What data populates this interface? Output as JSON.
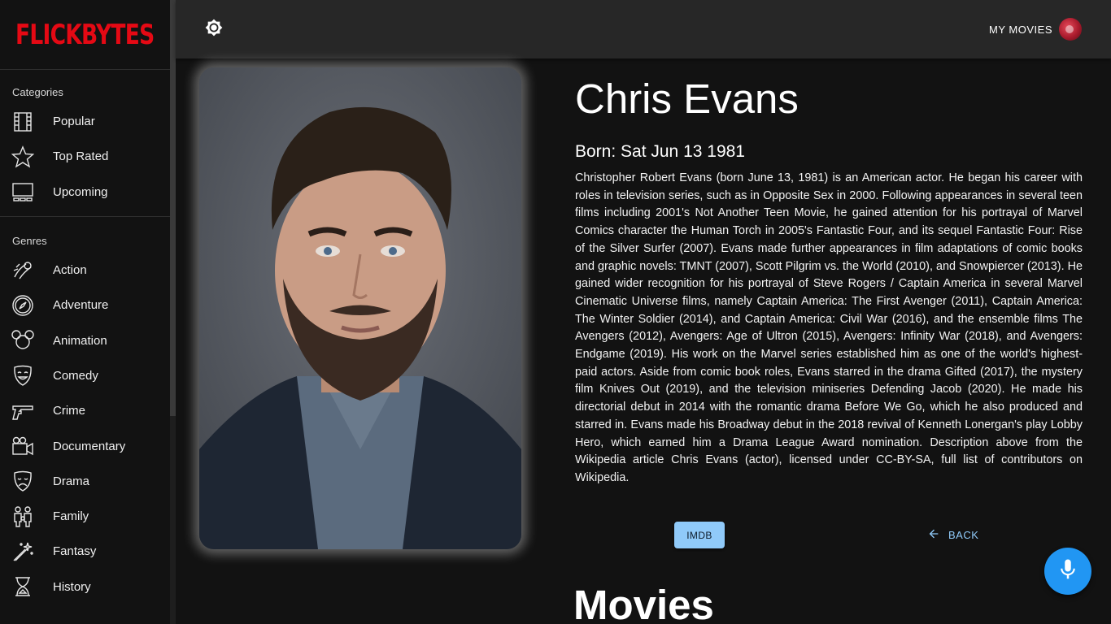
{
  "app": {
    "logo_text": "FLICKBYTES",
    "brand_color": "#e50914",
    "accent_color": "#90caf9"
  },
  "header": {
    "theme_toggle_icon": "brightness-icon",
    "my_movies_label": "MY MOVIES"
  },
  "sidebar": {
    "categories_label": "Categories",
    "categories": [
      {
        "label": "Popular",
        "icon": "film-icon"
      },
      {
        "label": "Top Rated",
        "icon": "star-icon"
      },
      {
        "label": "Upcoming",
        "icon": "screen-icon"
      }
    ],
    "genres_label": "Genres",
    "genres": [
      {
        "label": "Action",
        "icon": "action-icon"
      },
      {
        "label": "Adventure",
        "icon": "compass-icon"
      },
      {
        "label": "Animation",
        "icon": "mouse-ears-icon"
      },
      {
        "label": "Comedy",
        "icon": "comedy-mask-icon"
      },
      {
        "label": "Crime",
        "icon": "pistol-icon"
      },
      {
        "label": "Documentary",
        "icon": "video-camera-icon"
      },
      {
        "label": "Drama",
        "icon": "drama-mask-icon"
      },
      {
        "label": "Family",
        "icon": "family-icon"
      },
      {
        "label": "Fantasy",
        "icon": "magic-wand-icon"
      },
      {
        "label": "History",
        "icon": "hourglass-icon"
      }
    ]
  },
  "person": {
    "name": "Chris Evans",
    "born": "Born: Sat Jun 13 1981",
    "biography": "Christopher Robert Evans (born June 13, 1981) is an American actor. He began his career with roles in television series, such as in Opposite Sex in 2000. Following appearances in several teen films including 2001's Not Another Teen Movie, he gained attention for his portrayal of Marvel Comics character the Human Torch in 2005's Fantastic Four, and its sequel Fantastic Four: Rise of the Silver Surfer (2007). Evans made further appearances in film adaptations of comic books and graphic novels: TMNT (2007), Scott Pilgrim vs. the World (2010), and Snowpiercer (2013). He gained wider recognition for his portrayal of Steve Rogers / Captain America in several Marvel Cinematic Universe films, namely Captain America: The First Avenger (2011), Captain America: The Winter Soldier (2014), and Captain America: Civil War (2016), and the ensemble films The Avengers (2012), Avengers: Age of Ultron (2015), Avengers: Infinity War (2018), and Avengers: Endgame (2019). His work on the Marvel series established him as one of the world's highest-paid actors. Aside from comic book roles, Evans starred in the drama Gifted (2017), the mystery film Knives Out (2019), and the television miniseries Defending Jacob (2020). He made his directorial debut in 2014 with the romantic drama Before We Go, which he also produced and starred in. Evans made his Broadway debut in the 2018 revival of Kenneth Lonergan's play Lobby Hero, which earned him a Drama League Award nomination. Description above from the Wikipedia article Chris Evans (actor), licensed under CC-BY-SA, full list of contributors on Wikipedia."
  },
  "actions": {
    "imdb_label": "IMDB",
    "back_label": "BACK"
  },
  "movies_section_title": "Movies",
  "fab": {
    "icon": "microphone-icon"
  }
}
